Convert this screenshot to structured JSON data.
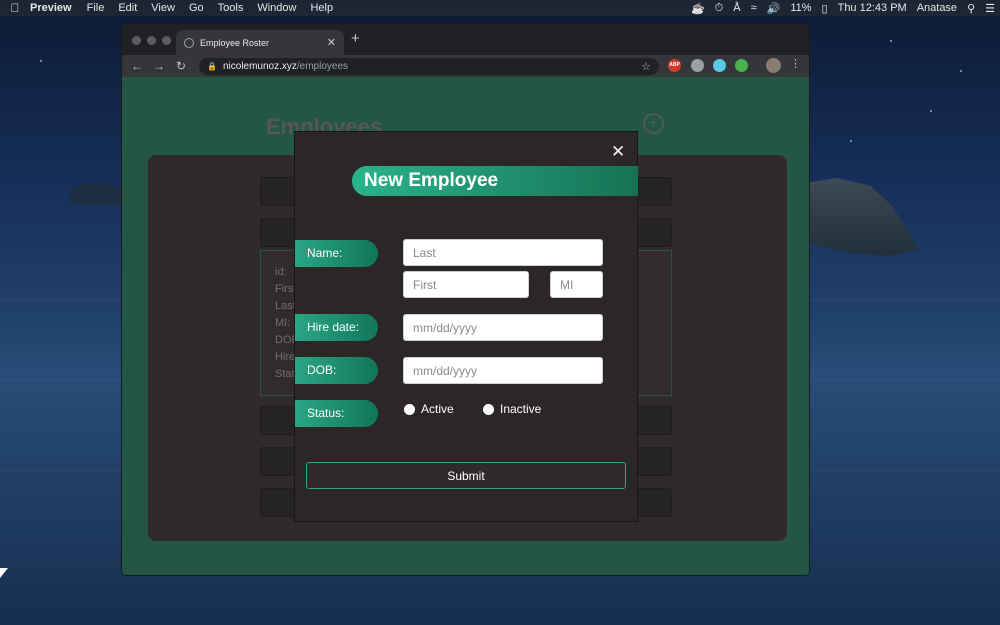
{
  "menubar": {
    "app_name": "Preview",
    "menus": [
      "File",
      "Edit",
      "View",
      "Go",
      "Tools",
      "Window",
      "Help"
    ],
    "battery": "11%",
    "clock": "Thu 12:43 PM",
    "user": "Anatase"
  },
  "browser": {
    "tab_title": "Employee Roster",
    "url_domain": "nicolemunoz.xyz",
    "url_path": "/employees",
    "extension_badge": "ABP"
  },
  "page": {
    "title": "Employees",
    "detail_labels": [
      "id:",
      "First",
      "Last",
      "MI:",
      "DOB",
      "Hire",
      "Stat"
    ]
  },
  "modal": {
    "title": "New Employee",
    "labels": {
      "name": "Name:",
      "hire_date": "Hire date:",
      "dob": "DOB:",
      "status": "Status:"
    },
    "placeholders": {
      "last": "Last",
      "first": "First",
      "mi": "MI",
      "hire_date": "mm/dd/yyyy",
      "dob": "mm/dd/yyyy"
    },
    "status_options": [
      "Active",
      "Inactive"
    ],
    "submit_label": "Submit"
  },
  "colors": {
    "accent": "#1f9d7a",
    "page_bg": "#2d6a54",
    "modal_bg": "#2b2726"
  }
}
